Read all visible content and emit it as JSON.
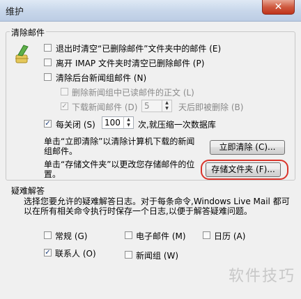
{
  "window": {
    "title": "维护",
    "close_glyph": "✕"
  },
  "cleanup": {
    "group_label": "清除邮件",
    "empty_deleted": {
      "label": "退出时清空“已删除邮件”文件夹中的邮件 (E)",
      "checked": false
    },
    "purge_imap": {
      "label": "离开 IMAP 文件夹时清空已删除邮件 (P)",
      "checked": false
    },
    "purge_background": {
      "label": "清除后台新闻组邮件 (N)",
      "checked": false
    },
    "delete_read_body": {
      "label": "删除新闻组中已读邮件的正文 (L)",
      "checked": false
    },
    "delete_downloaded": {
      "label": "下载新闻邮件 (D)",
      "checked": true,
      "days_value": "5",
      "suffix": "天后即被删除 (B)"
    },
    "compact": {
      "label": "每关闭 (S)",
      "checked": true,
      "value": "100",
      "suffix": "次,就压缩一次数据库"
    },
    "clean_now_text": "单击“立即清除”以清除计算机下载的新闻组邮件。",
    "clean_now_button": "立即清除 (C)...",
    "store_text": "单击“存储文件夹”以更改您存储邮件的位置。",
    "store_button": "存储文件夹 (F)..."
  },
  "troubleshooting": {
    "group_label": "疑难解答",
    "description": "选择您要允许的疑难解答日志。对于每条命令,Windows Live Mail 都可以在所有相关命令执行时保存一个日志,以便于解答疑难问题。",
    "options": [
      {
        "label": "常规 (G)",
        "checked": false
      },
      {
        "label": "电子邮件 (M)",
        "checked": false
      },
      {
        "label": "日历 (A)",
        "checked": false
      },
      {
        "label": "联系人 (O)",
        "checked": true
      },
      {
        "label": "新闻组 (W)",
        "checked": false
      }
    ]
  },
  "icons": {
    "cleanup": "broom-icon",
    "spin": "spin-arrows-icon"
  },
  "colors": {
    "highlight": "#d9342b",
    "close": "#c0341b"
  },
  "watermark": "软件技巧"
}
